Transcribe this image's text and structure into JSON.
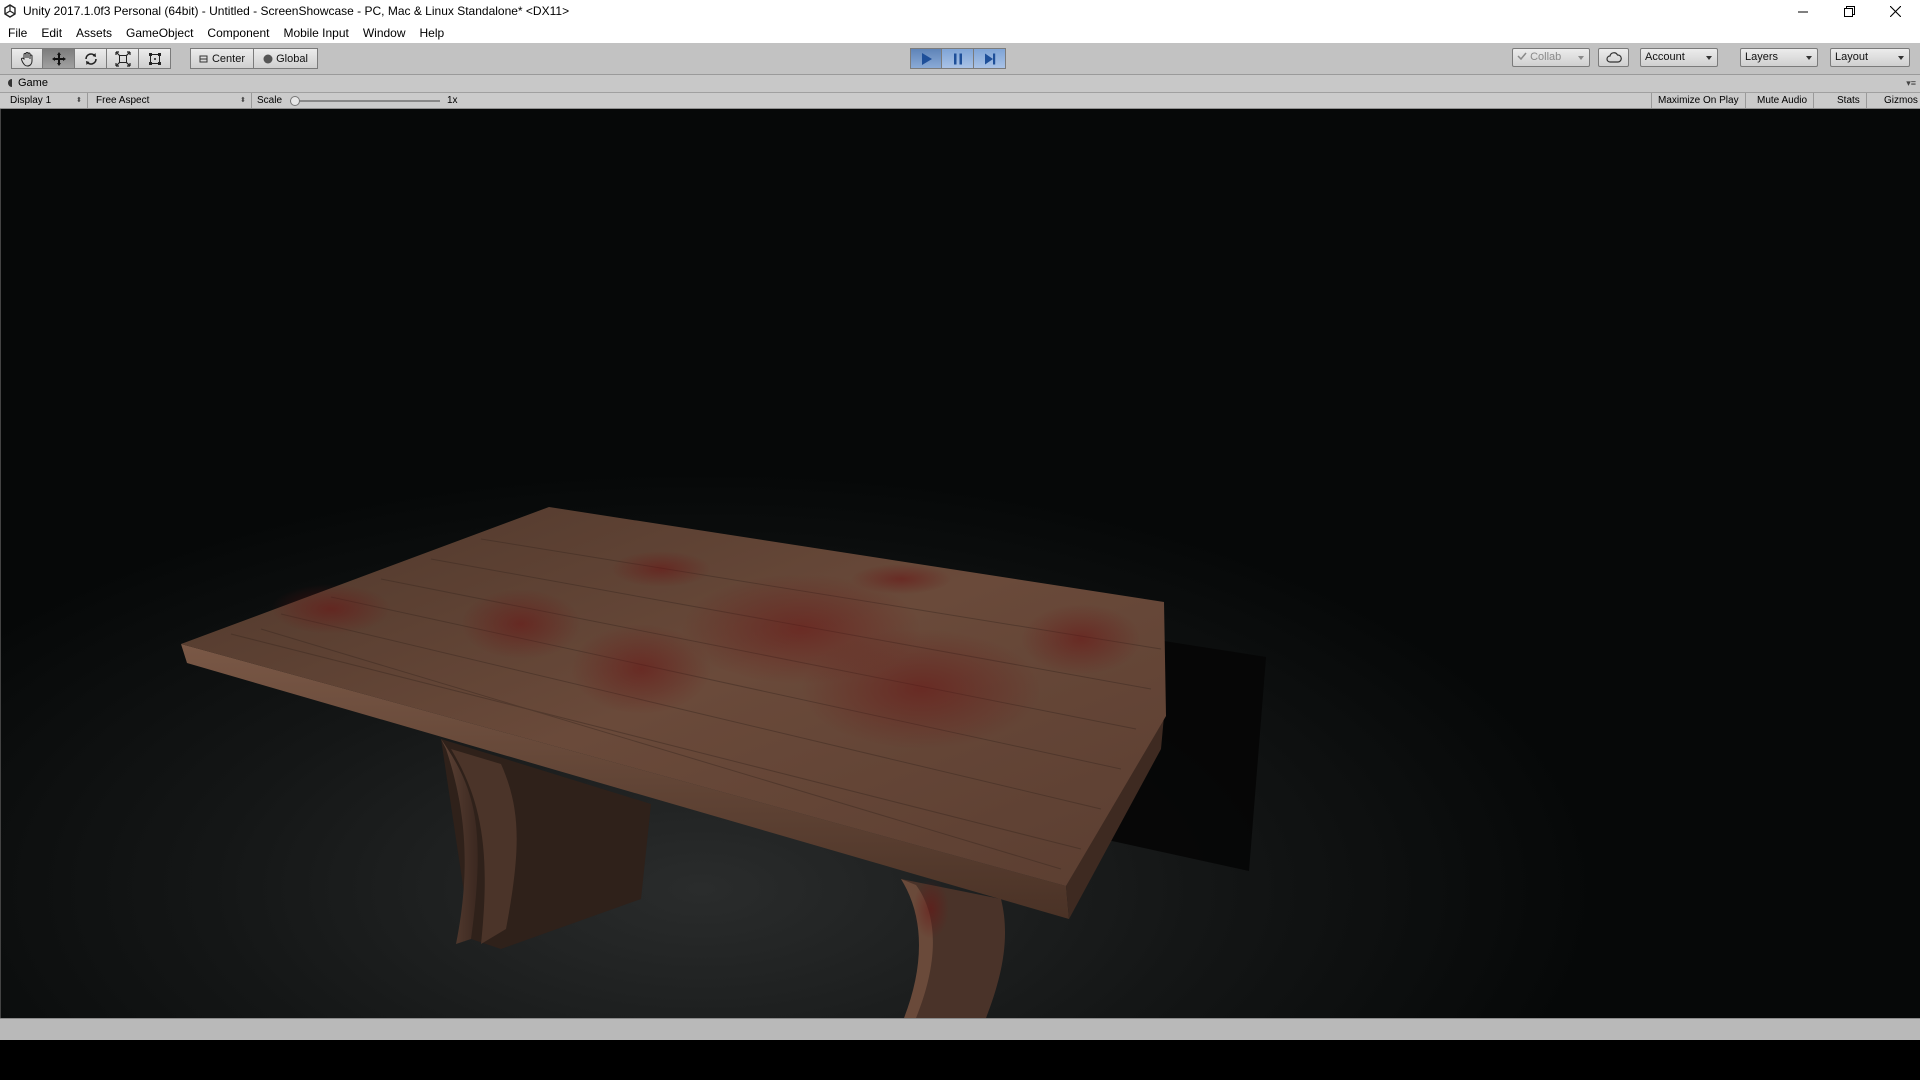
{
  "window": {
    "title": "Unity 2017.1.0f3 Personal (64bit) - Untitled - ScreenShowcase - PC, Mac & Linux Standalone* <DX11>"
  },
  "menu": {
    "items": [
      "File",
      "Edit",
      "Assets",
      "GameObject",
      "Component",
      "Mobile Input",
      "Window",
      "Help"
    ]
  },
  "toolbar": {
    "tools": [
      "hand-icon",
      "move-icon",
      "rotate-icon",
      "scale-icon",
      "rect-icon"
    ],
    "active_tool": "move-icon",
    "pivot_label": "Center",
    "space_label": "Global",
    "play_state": "playing",
    "collab_label": "Collab",
    "account_label": "Account",
    "layers_label": "Layers",
    "layout_label": "Layout"
  },
  "game_panel": {
    "tab_label": "Game",
    "display_label": "Display 1",
    "aspect_label": "Free Aspect",
    "scale_label": "Scale",
    "scale_value": "1x",
    "maximize_label": "Maximize On Play",
    "mute_label": "Mute Audio",
    "stats_label": "Stats",
    "gizmos_label": "Gizmos"
  },
  "colors": {
    "toolbar_bg": "#c2c2c2",
    "play_active": "#6f93c6",
    "viewport_bg": "#070909",
    "wood": "#5a3d2e"
  }
}
